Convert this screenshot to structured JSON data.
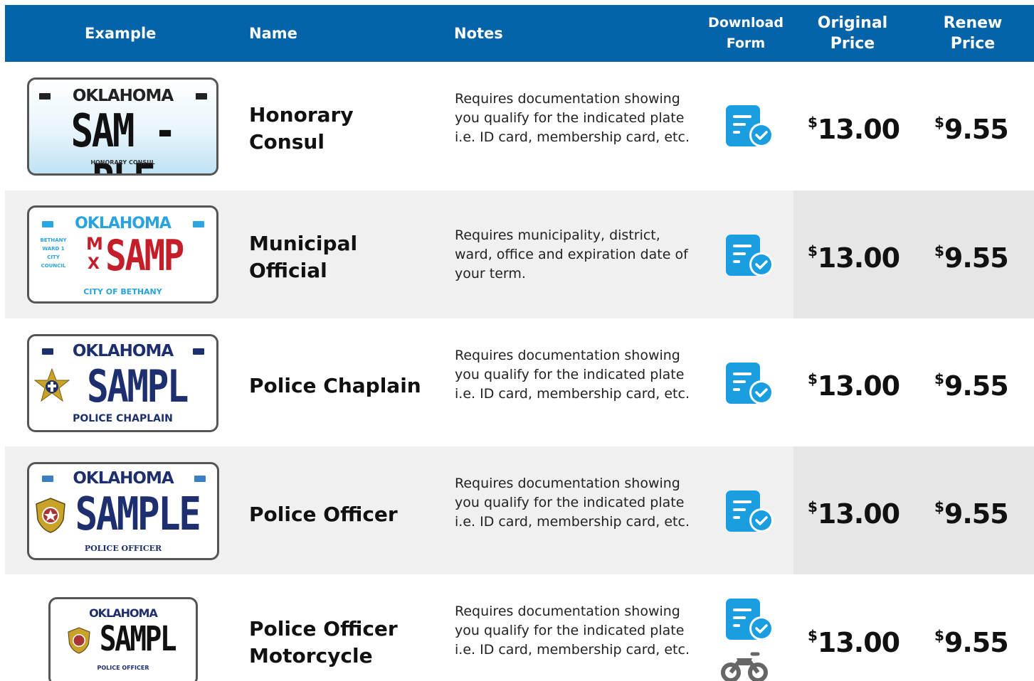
{
  "header": {
    "example": "Example",
    "name": "Name",
    "notes": "Notes",
    "download_form_line1": "Download",
    "download_form_line2": "Form",
    "original_price_line1": "Original",
    "original_price_line2": "Price",
    "renew_price_line1": "Renew",
    "renew_price_line2": "Price"
  },
  "colors": {
    "header_bg": "#0563a9",
    "icon_blue": "#1a9ee0",
    "row_alt": "#f0f0f0"
  },
  "rows": [
    {
      "name_line1": "Honorary",
      "name_line2": "Consul",
      "notes": "Requires documentation showing you qualify for the indicated plate i.e. ID card, membership card, etc.",
      "plate": {
        "state": "OKLAHOMA",
        "number": "SAM - PLE",
        "footer": "HONORARY CONSUL"
      },
      "currency": "$",
      "original_price": "13.00",
      "renew_price": "9.55",
      "icons": [
        "document-check-icon"
      ]
    },
    {
      "name_line1": "Municipal",
      "name_line2": "Official",
      "notes": "Requires municipality, district, ward, office and expiration date of your term.",
      "plate": {
        "state": "OKLAHOMA",
        "number": "SAMP",
        "side_text": "BETHANY WARD 1 CITY COUNCIL",
        "mx_top": "M",
        "mx_bottom": "X",
        "footer": "CITY OF BETHANY"
      },
      "currency": "$",
      "original_price": "13.00",
      "renew_price": "9.55",
      "icons": [
        "document-check-icon"
      ]
    },
    {
      "name_line1": "Police Chaplain",
      "name_line2": "",
      "notes": "Requires documentation showing you qualify for the indicated plate i.e. ID card, membership card, etc.",
      "plate": {
        "state": "OKLAHOMA",
        "number": "SAMPL",
        "footer": "POLICE CHAPLAIN"
      },
      "currency": "$",
      "original_price": "13.00",
      "renew_price": "9.55",
      "icons": [
        "document-check-icon"
      ]
    },
    {
      "name_line1": "Police Officer",
      "name_line2": "",
      "notes": "Requires documentation showing you qualify for the indicated plate i.e. ID card, membership card, etc.",
      "plate": {
        "state": "OKLAHOMA",
        "number": "SAMPLE",
        "footer": "POLICE OFFICER"
      },
      "currency": "$",
      "original_price": "13.00",
      "renew_price": "9.55",
      "icons": [
        "document-check-icon"
      ]
    },
    {
      "name_line1": "Police Officer",
      "name_line2": "Motorcycle",
      "notes": "Requires documentation showing you qualify for the indicated plate i.e. ID card, membership card, etc.",
      "plate": {
        "state": "OKLAHOMA",
        "number": "SAMPL",
        "footer": "POLICE OFFICER"
      },
      "currency": "$",
      "original_price": "13.00",
      "renew_price": "9.55",
      "icons": [
        "document-check-icon",
        "motorcycle-icon"
      ]
    }
  ]
}
